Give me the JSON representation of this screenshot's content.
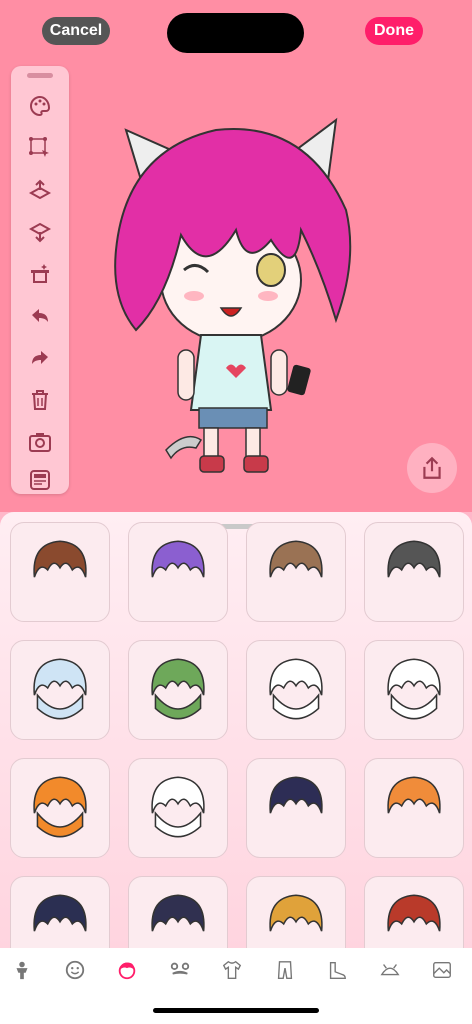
{
  "header": {
    "cancel_label": "Cancel",
    "done_label": "Done"
  },
  "colors": {
    "accent": "#ff1e6a",
    "background": "#ff8ea4",
    "toolbar": "#ffc7d3",
    "icon": "#9c3b52"
  },
  "toolbar": {
    "items": [
      "palette-icon",
      "transform-icon",
      "bring-forward-icon",
      "send-backward-icon",
      "magic-hat-icon",
      "undo-icon",
      "redo-icon",
      "trash-icon",
      "camera-icon",
      "card-icon"
    ]
  },
  "hair_options": [
    {
      "name": "brown-spiky-hair"
    },
    {
      "name": "purple-spiky-hair"
    },
    {
      "name": "light-brown-hair"
    },
    {
      "name": "dark-gray-hair"
    },
    {
      "name": "dragon-hood-blue"
    },
    {
      "name": "dinosaur-hood-green"
    },
    {
      "name": "panda-hood"
    },
    {
      "name": "cat-hood-white"
    },
    {
      "name": "tiger-hood"
    },
    {
      "name": "cow-hood"
    },
    {
      "name": "navy-hair-headband"
    },
    {
      "name": "orange-cat-ears-hair"
    },
    {
      "name": "navy-hair-long"
    },
    {
      "name": "navy-hair-short"
    },
    {
      "name": "tiger-striped-hair"
    },
    {
      "name": "red-spiky-hair"
    }
  ],
  "tabs": [
    {
      "name": "body-tab"
    },
    {
      "name": "face-tab"
    },
    {
      "name": "hair-tab",
      "active": true
    },
    {
      "name": "facial-hair-tab"
    },
    {
      "name": "top-tab"
    },
    {
      "name": "pants-tab"
    },
    {
      "name": "shoes-tab"
    },
    {
      "name": "hat-tab"
    },
    {
      "name": "background-tab"
    }
  ]
}
